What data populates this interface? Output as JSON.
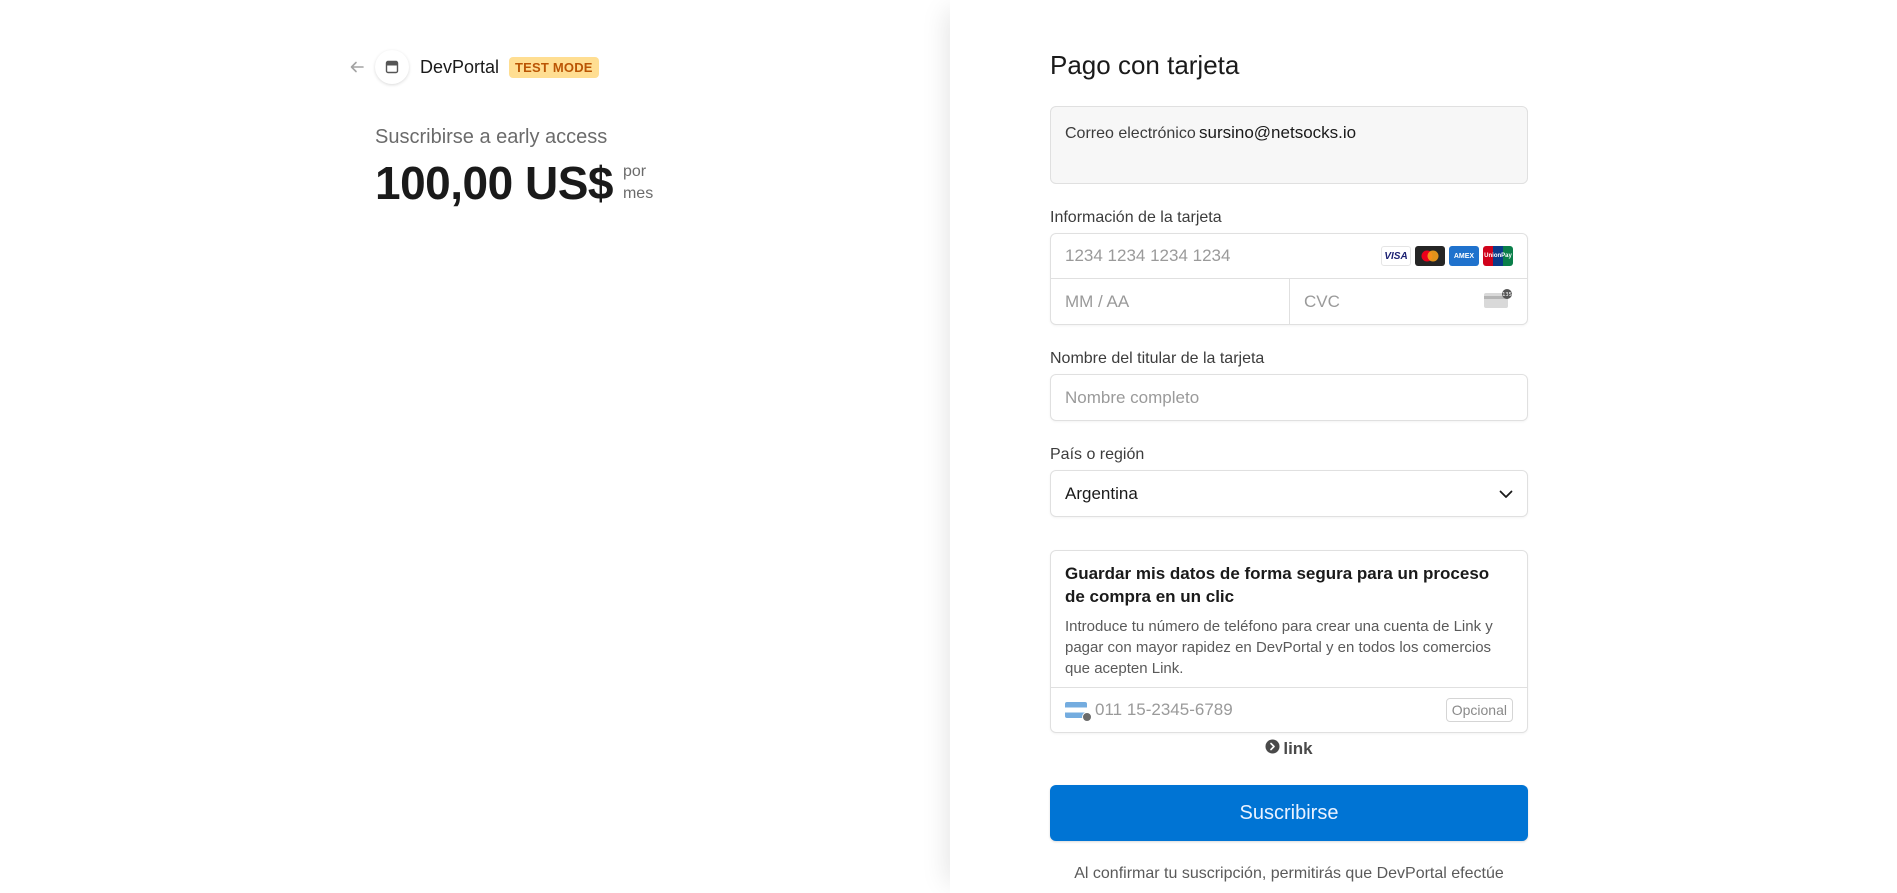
{
  "header": {
    "back_icon": "arrow-left-icon",
    "store_icon": "storefront-icon",
    "brand": "DevPortal",
    "badge": "TEST MODE"
  },
  "summary": {
    "product": "Suscribirse a early access",
    "price": "100,00 US$",
    "interval_line1": "por",
    "interval_line2": "mes"
  },
  "form": {
    "title": "Pago con tarjeta",
    "email": {
      "label": "Correo electrónico",
      "value": "sursino@netsocks.io"
    },
    "card": {
      "label": "Información de la tarjeta",
      "number_placeholder": "1234 1234 1234 1234",
      "expiry_placeholder": "MM / AA",
      "cvc_placeholder": "CVC",
      "logos": {
        "visa": "VISA",
        "mastercard_icon": "mastercard-icon",
        "amex": "AMEX",
        "unionpay": "UnionPay"
      },
      "cvc_icon": "card-cvc-icon"
    },
    "name": {
      "label": "Nombre del titular de la tarjeta",
      "placeholder": "Nombre completo"
    },
    "country": {
      "label": "País o región",
      "value": "Argentina",
      "icon": "chevron-down-icon"
    },
    "link": {
      "title": "Guardar mis datos de forma segura para un proceso de compra en un clic",
      "description": "Introduce tu número de teléfono para crear una cuenta de Link y pagar con mayor rapidez en DevPortal y en todos los comercios que acepten Link.",
      "phone_placeholder": "011 15-2345-6789",
      "optional": "Opcional",
      "flag_icon": "argentina-flag-icon",
      "brand": "link"
    },
    "submit": "Suscribirse",
    "terms": "Al confirmar tu suscripción, permitirás que DevPortal efectúe"
  },
  "colors": {
    "primary": "#0074d4",
    "badge_bg": "#ffde92",
    "badge_text": "#bb5504"
  }
}
